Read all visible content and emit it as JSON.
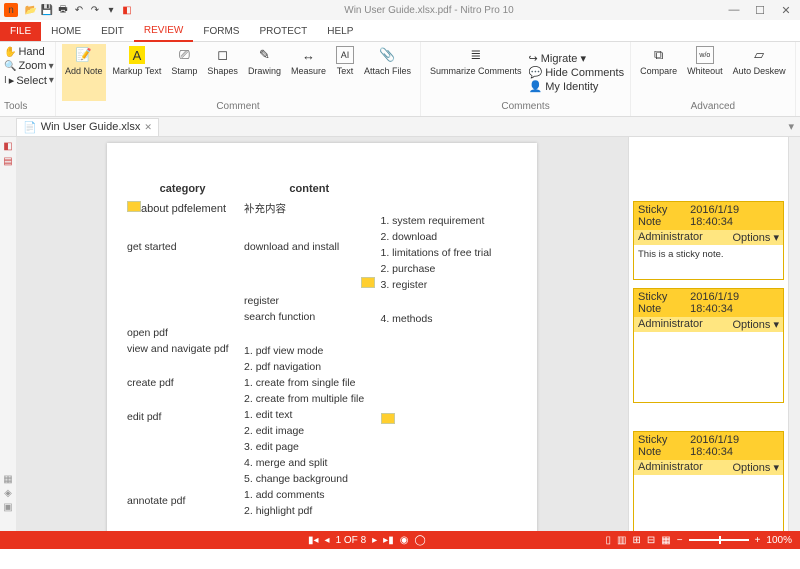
{
  "app": {
    "title": "Win User Guide.xlsx.pdf - Nitro Pro 10"
  },
  "menu": {
    "file": "FILE",
    "home": "HOME",
    "edit": "EDIT",
    "review": "REVIEW",
    "forms": "FORMS",
    "protect": "PROTECT",
    "help": "HELP"
  },
  "tools": {
    "label": "Tools",
    "hand": "Hand",
    "zoom": "Zoom",
    "select": "Select"
  },
  "comment_group": {
    "label": "Comment",
    "add_note": "Add\nNote",
    "markup": "Markup\nText",
    "stamp": "Stamp",
    "shapes": "Shapes",
    "drawing": "Drawing",
    "measure": "Measure",
    "text": "Text",
    "attach": "Attach\nFiles"
  },
  "comments_group": {
    "label": "Comments",
    "summarize": "Summarize\nComments",
    "migrate": "Migrate",
    "hide": "Hide Comments",
    "identity": "My Identity"
  },
  "advanced_group": {
    "label": "Advanced",
    "compare": "Compare",
    "whiteout": "Whiteout",
    "deskew": "Auto\nDeskew"
  },
  "doc_tab": "Win User Guide.xlsx",
  "page": {
    "cat_header": "category",
    "content_header": "content",
    "about": "about pdfelement",
    "about_cn": "补充内容",
    "get_started": "get started",
    "download": "download and install",
    "sysreq": "1. system requirement",
    "dl": "2. download",
    "limit": "1. limitations of free trial",
    "purchase": "2. purchase",
    "reg3": "3. register",
    "register": "register",
    "search": "search function",
    "methods": "4. methods",
    "open": "open pdf",
    "view": "view and navigate pdf",
    "viewmode": "1. pdf view mode",
    "nav": "2. pdf navigation",
    "create": "create pdf",
    "single": "1. create from single file",
    "multi": "2. create from multiple file",
    "edit": "edit pdf",
    "etext": "1. edit text",
    "eimg": "2. edit image",
    "epage": "3. edit page",
    "merge": "4. merge and split",
    "bg": "5. change background",
    "annotate": "annotate pdf",
    "addc": "1. add comments",
    "hl": "2. highlight pdf"
  },
  "sticky": {
    "title": "Sticky Note",
    "date": "2016/1/19 18:40:34",
    "author": "Administrator",
    "options": "Options",
    "body1": "This is a sticky note."
  },
  "status": {
    "page": "1 OF 8",
    "zoom": "100%"
  }
}
